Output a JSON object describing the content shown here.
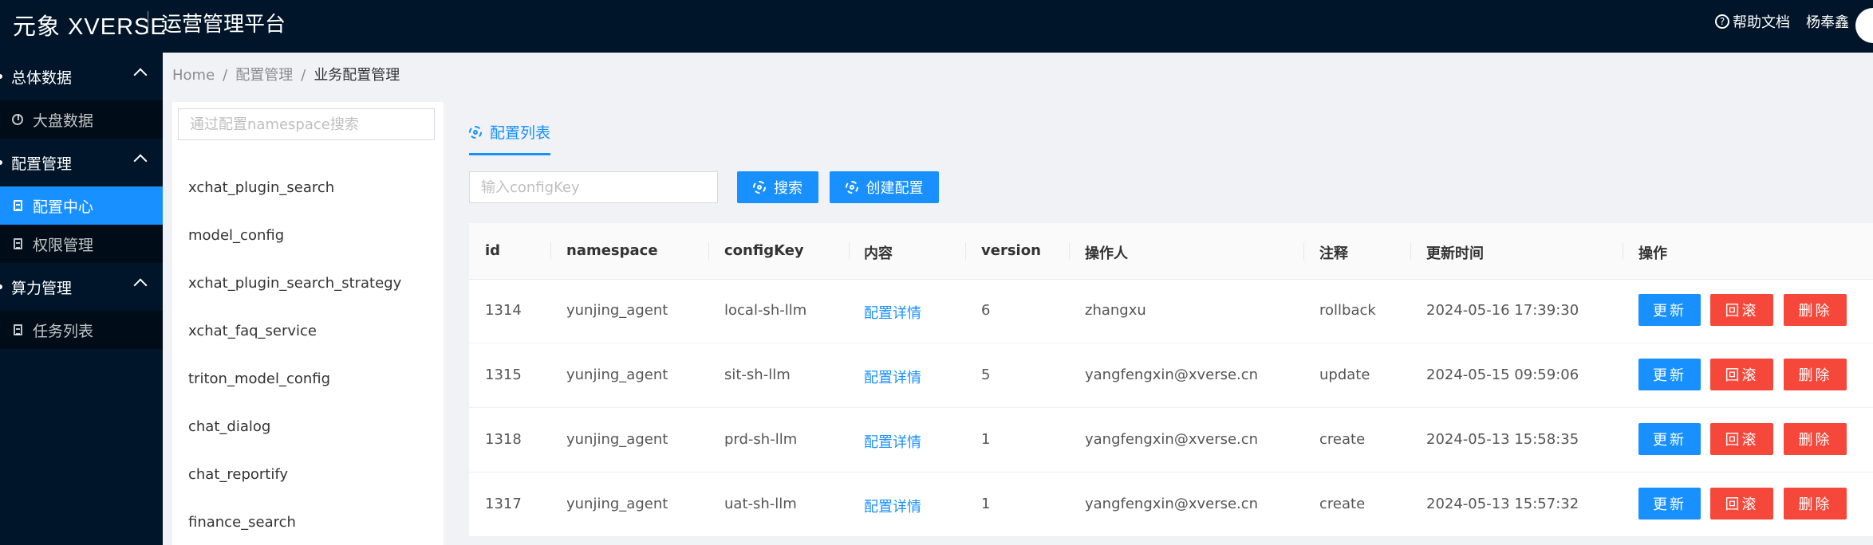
{
  "header": {
    "logo_text": "元象 XVERSE",
    "app_title": "运营管理平台",
    "help_label": "帮助文档",
    "user_name": "杨奉鑫"
  },
  "sidebar": {
    "groups": [
      {
        "label": "总体数据",
        "items": [
          {
            "label": "大盘数据",
            "icon": "pie-chart-icon"
          }
        ]
      },
      {
        "label": "配置管理",
        "items": [
          {
            "label": "配置中心",
            "icon": "file-icon",
            "active": true
          },
          {
            "label": "权限管理",
            "icon": "file-icon"
          }
        ]
      },
      {
        "label": "算力管理",
        "items": [
          {
            "label": "任务列表",
            "icon": "file-icon"
          }
        ]
      }
    ]
  },
  "breadcrumb": {
    "home": "Home",
    "sep": "/",
    "level1": "配置管理",
    "current": "业务配置管理"
  },
  "namespace_panel": {
    "search_placeholder": "通过配置namespace搜索",
    "items": [
      "xchat_plugin_search",
      "model_config",
      "xchat_plugin_search_strategy",
      "xchat_faq_service",
      "triton_model_config",
      "chat_dialog",
      "chat_reportify",
      "finance_search"
    ]
  },
  "main": {
    "tab_label": "配置列表",
    "key_placeholder": "输入configKey",
    "search_button": "搜索",
    "create_button": "创建配置",
    "columns": [
      "id",
      "namespace",
      "configKey",
      "内容",
      "version",
      "操作人",
      "注释",
      "更新时间",
      "操作"
    ],
    "rows": [
      {
        "id": "1314",
        "namespace": "yunjing_agent",
        "configKey": "local-sh-llm",
        "content": "配置详情",
        "version": "6",
        "operator": "zhangxu",
        "note": "rollback",
        "updated": "2024-05-16 17:39:30"
      },
      {
        "id": "1315",
        "namespace": "yunjing_agent",
        "configKey": "sit-sh-llm",
        "content": "配置详情",
        "version": "5",
        "operator": "yangfengxin@xverse.cn",
        "note": "update",
        "updated": "2024-05-15 09:59:06"
      },
      {
        "id": "1318",
        "namespace": "yunjing_agent",
        "configKey": "prd-sh-llm",
        "content": "配置详情",
        "version": "1",
        "operator": "yangfengxin@xverse.cn",
        "note": "create",
        "updated": "2024-05-13 15:58:35"
      },
      {
        "id": "1317",
        "namespace": "yunjing_agent",
        "configKey": "uat-sh-llm",
        "content": "配置详情",
        "version": "1",
        "operator": "yangfengxin@xverse.cn",
        "note": "create",
        "updated": "2024-05-13 15:57:32"
      }
    ],
    "actions": {
      "update": "更新",
      "rollback": "回滚",
      "delete": "删除"
    }
  },
  "colors": {
    "primary": "#1890ff",
    "danger": "#f5483b",
    "sidebar_bg": "#001529"
  }
}
